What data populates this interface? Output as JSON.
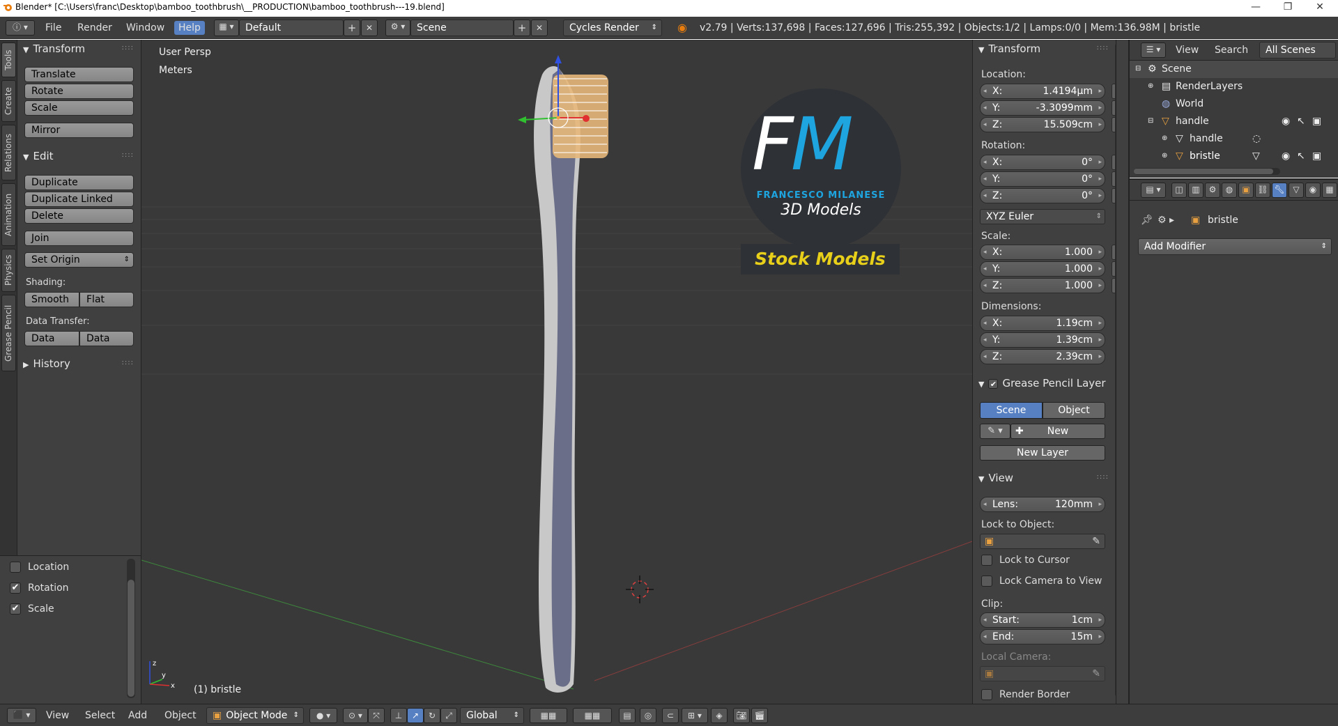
{
  "window": {
    "title": "Blender* [C:\\Users\\franc\\Desktop\\bamboo_toothbrush\\__PRODUCTION\\bamboo_toothbrush---19.blend]",
    "minimize": "—",
    "maximize": "❐",
    "close": "✕"
  },
  "topbar": {
    "menus": [
      "File",
      "Render",
      "Window",
      "Help"
    ],
    "layout": "Default",
    "scene": "Scene",
    "engine": "Cycles Render",
    "stats": "v2.79 | Verts:137,698 | Faces:127,696 | Tris:255,392 | Objects:1/2 | Lamps:0/0 | Mem:136.98M | bristle"
  },
  "left_tabs": [
    "Tools",
    "Create",
    "Relations",
    "Animation",
    "Physics",
    "Grease Pencil"
  ],
  "tools": {
    "transform_header": "Transform",
    "translate": "Translate",
    "rotate": "Rotate",
    "scale": "Scale",
    "mirror": "Mirror",
    "edit_header": "Edit",
    "duplicate": "Duplicate",
    "duplicate_linked": "Duplicate Linked",
    "delete": "Delete",
    "join": "Join",
    "set_origin": "Set Origin",
    "shading_label": "Shading:",
    "smooth": "Smooth",
    "flat": "Flat",
    "data_transfer_label": "Data Transfer:",
    "data": "Data",
    "data_layout": "Data Layo",
    "history_header": "History"
  },
  "operator_panel": {
    "location": {
      "label": "Location",
      "checked": false
    },
    "rotation": {
      "label": "Rotation",
      "checked": true
    },
    "scale": {
      "label": "Scale",
      "checked": true
    }
  },
  "viewport": {
    "view_name": "User Persp",
    "units": "Meters",
    "object_label": "(1) bristle",
    "logo": {
      "letters_f": "F",
      "letters_m": "M",
      "name": "FRANCESCO MILANESE",
      "sub": "3D Models",
      "banner": "Stock Models"
    }
  },
  "npanel": {
    "transform_header": "Transform",
    "location_label": "Location:",
    "location": [
      {
        "k": "X:",
        "v": "1.4194µm"
      },
      {
        "k": "Y:",
        "v": "-3.3099mm"
      },
      {
        "k": "Z:",
        "v": "15.509cm"
      }
    ],
    "rotation_label": "Rotation:",
    "rotation": [
      {
        "k": "X:",
        "v": "0°"
      },
      {
        "k": "Y:",
        "v": "0°"
      },
      {
        "k": "Z:",
        "v": "0°"
      }
    ],
    "rotation_mode": "XYZ Euler",
    "scale_label": "Scale:",
    "scale": [
      {
        "k": "X:",
        "v": "1.000"
      },
      {
        "k": "Y:",
        "v": "1.000"
      },
      {
        "k": "Z:",
        "v": "1.000"
      }
    ],
    "dimensions_label": "Dimensions:",
    "dimensions": [
      {
        "k": "X:",
        "v": "1.19cm"
      },
      {
        "k": "Y:",
        "v": "1.39cm"
      },
      {
        "k": "Z:",
        "v": "2.39cm"
      }
    ],
    "grease_header": "Grease Pencil Layer",
    "scene_btn": "Scene",
    "object_btn": "Object",
    "new_btn": "New",
    "new_layer_btn": "New Layer",
    "view_header": "View",
    "lens": {
      "k": "Lens:",
      "v": "120mm"
    },
    "lock_to_object_label": "Lock to Object:",
    "lock_to_cursor": "Lock to Cursor",
    "lock_camera": "Lock Camera to View",
    "clip_label": "Clip:",
    "clip_start": {
      "k": "Start:",
      "v": "1cm"
    },
    "clip_end": {
      "k": "End:",
      "v": "15m"
    },
    "local_camera_label": "Local Camera:",
    "render_border": "Render Border"
  },
  "outliner": {
    "menus": [
      "View",
      "Search"
    ],
    "filter": "All Scenes",
    "rows": [
      "Scene",
      "RenderLayers",
      "World",
      "handle",
      "handle",
      "bristle"
    ]
  },
  "properties": {
    "object": "bristle",
    "add_modifier": "Add Modifier"
  },
  "bottombar": {
    "menus": [
      "View",
      "Select",
      "Add",
      "Object"
    ],
    "mode": "Object Mode",
    "orientation": "Global"
  },
  "colors": {
    "accent": "#5680c2",
    "panel": "#404040",
    "viewport": "#393939",
    "logo_blue": "#1ea5e0",
    "banner_yellow": "#e8d01a",
    "handle": "#6b6e88"
  }
}
